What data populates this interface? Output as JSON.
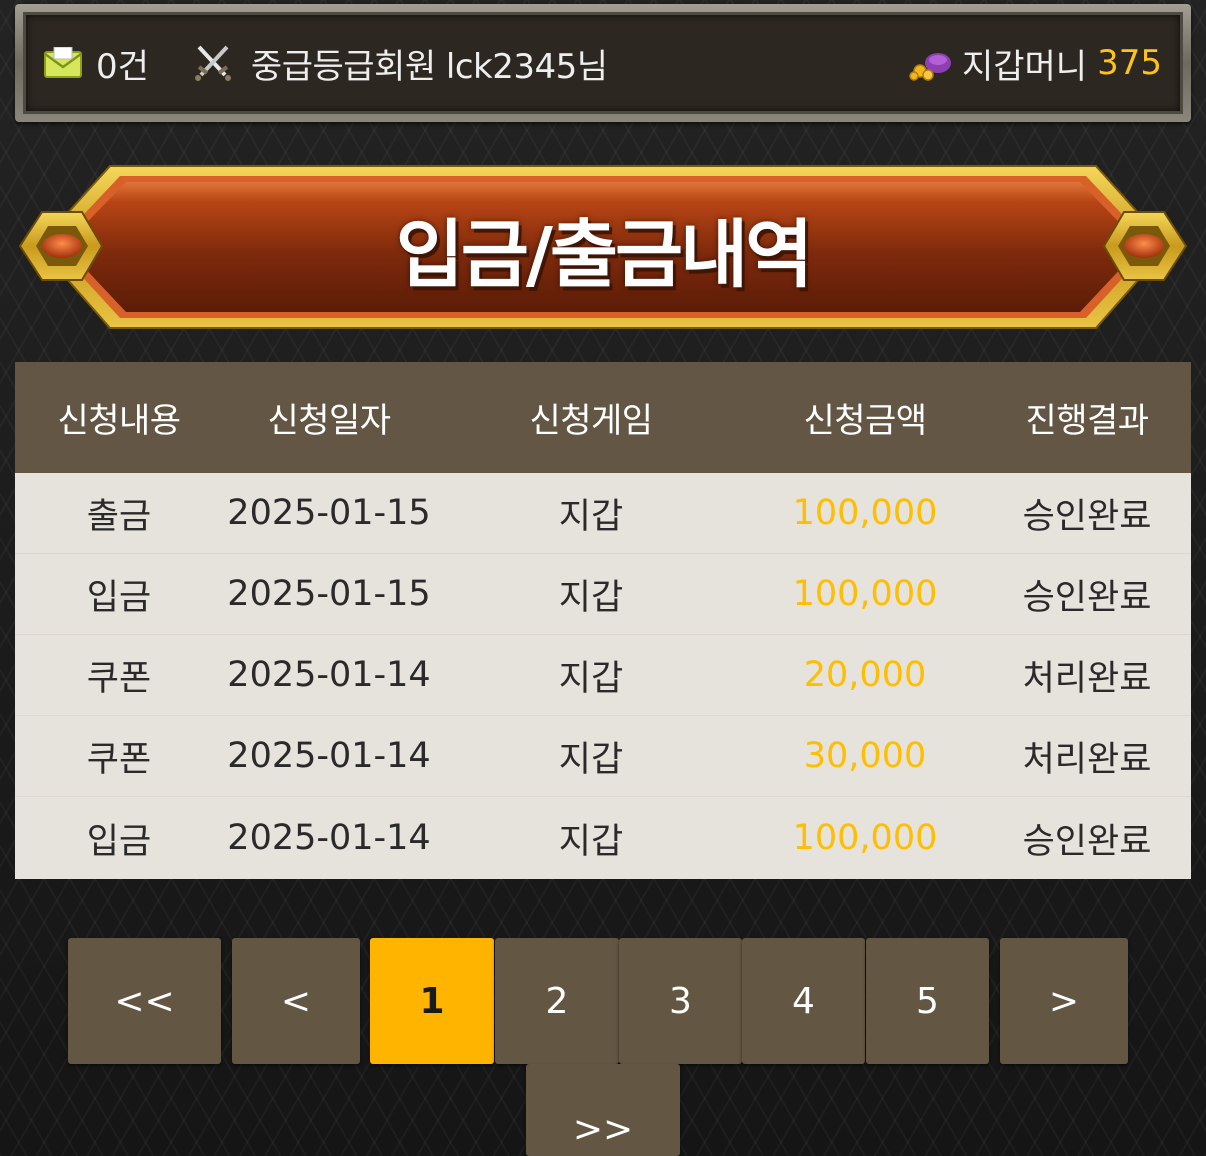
{
  "topbar": {
    "mail_count": "0건",
    "user_text": "중급등급회원 lck2345님",
    "money_label": "지갑머니",
    "money_value": "375"
  },
  "banner": {
    "title": "입금/출금내역"
  },
  "table": {
    "headers": [
      "신청내용",
      "신청일자",
      "신청게임",
      "신청금액",
      "진행결과"
    ],
    "rows": [
      [
        "출금",
        "2025-01-15",
        "지갑",
        "100,000",
        "승인완료"
      ],
      [
        "입금",
        "2025-01-15",
        "지갑",
        "100,000",
        "승인완료"
      ],
      [
        "쿠폰",
        "2025-01-14",
        "지갑",
        "20,000",
        "처리완료"
      ],
      [
        "쿠폰",
        "2025-01-14",
        "지갑",
        "30,000",
        "처리완료"
      ],
      [
        "입금",
        "2025-01-14",
        "지갑",
        "100,000",
        "승인완료"
      ]
    ]
  },
  "pagination": {
    "first": "<<",
    "prev": "<",
    "pages": [
      "1",
      "2",
      "3",
      "4",
      "5"
    ],
    "current": "1",
    "next": ">",
    "last": ">>"
  },
  "colors": {
    "accent": "#ffb400",
    "amount": "#ffbe00",
    "header_bg": "#645644",
    "row_bg": "#e6e2dc",
    "banner_red": "#8a2a0c"
  },
  "icons": [
    "mail-icon",
    "crossed-swords-icon",
    "wallet-icon",
    "gem-ornament-icon"
  ]
}
